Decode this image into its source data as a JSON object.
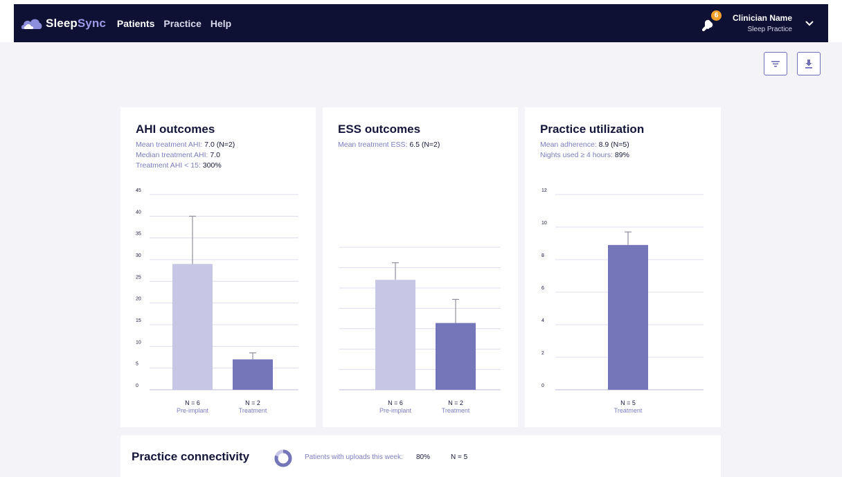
{
  "app": {
    "logo_part1": "Sleep",
    "logo_part2": "Sync",
    "nav": [
      {
        "label": "Patients",
        "active": true
      },
      {
        "label": "Practice",
        "active": false
      },
      {
        "label": "Help",
        "active": false
      }
    ],
    "notifications_count": "6",
    "user": {
      "name": "Clinician Name",
      "practice": "Sleep Practice"
    }
  },
  "toolbar": {
    "filter_icon": "filter-icon",
    "download_icon": "download-icon"
  },
  "cards": {
    "ahi": {
      "title": "AHI outcomes",
      "stats": [
        {
          "label": "Mean treatment AHI:",
          "value": "7.0 (N=2)"
        },
        {
          "label": "Median treatment AHI:",
          "value": "7.0"
        },
        {
          "label": "Treatment AHI < 15:",
          "value": "300%"
        }
      ]
    },
    "ess": {
      "title": "ESS outcomes",
      "stats": [
        {
          "label": "Mean treatment ESS:",
          "value": "6.5 (N=2)"
        }
      ]
    },
    "util": {
      "title": "Practice utilization",
      "stats": [
        {
          "label": "Mean adherence:",
          "value": "8.9 (N=5)"
        },
        {
          "label": "Nights used ≥ 4 hours:",
          "value": "89%"
        }
      ]
    }
  },
  "connectivity": {
    "title": "Practice connectivity",
    "label": "Patients with uploads this week:",
    "percent": "80%",
    "percent_value": 80,
    "n": "N = 5"
  },
  "colors": {
    "navy": "#0f1134",
    "pre_implant": "#c8c6e5",
    "treatment": "#7576ba",
    "accent": "#7c7cbf",
    "badge": "#f0a02a"
  },
  "chart_data": [
    {
      "type": "bar",
      "id": "ahi",
      "categories": [
        "Pre-implant",
        "Treatment"
      ],
      "n_labels": [
        "N = 6",
        "N = 2"
      ],
      "values": [
        29,
        7
      ],
      "error_upper": [
        40,
        8.5
      ],
      "ylim": [
        0,
        45
      ],
      "yticks": [
        0,
        5,
        10,
        15,
        20,
        25,
        30,
        35,
        40,
        45
      ],
      "show_tick_labels": true,
      "grid": true
    },
    {
      "type": "bar",
      "id": "ess",
      "categories": [
        "Pre-implant",
        "Treatment"
      ],
      "n_labels": [
        "N = 6",
        "N = 2"
      ],
      "values": [
        13.5,
        8.2
      ],
      "error_upper": [
        15.6,
        11.1
      ],
      "ylim": [
        0,
        21
      ],
      "yticks": [
        0,
        2.5,
        5,
        7.5,
        10,
        12.5,
        15,
        17.5
      ],
      "show_tick_labels": false,
      "grid": true
    },
    {
      "type": "bar",
      "id": "util",
      "categories": [
        "Treatment"
      ],
      "n_labels": [
        "N = 5"
      ],
      "values": [
        8.9
      ],
      "error_upper": [
        9.7
      ],
      "ylim": [
        0,
        12
      ],
      "yticks": [
        0,
        2,
        4,
        6,
        8,
        10,
        12
      ],
      "show_tick_labels": true,
      "grid": true
    }
  ]
}
